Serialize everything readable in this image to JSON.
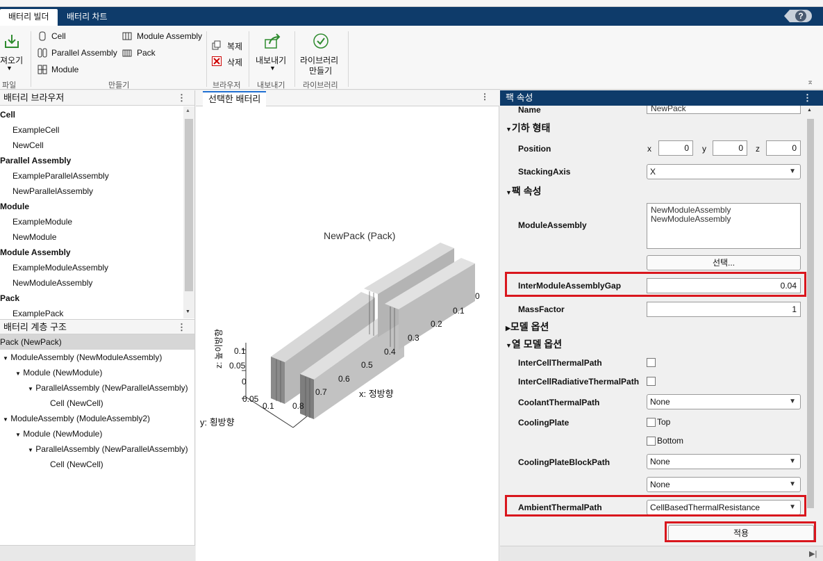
{
  "tabs": {
    "builder": "배터리 빌더",
    "chart": "배터리 차트"
  },
  "help_label": "?",
  "ribbon": {
    "file": {
      "import_label": "져오기",
      "section": "파일"
    },
    "create": {
      "cell": "Cell",
      "parallel": "Parallel Assembly",
      "module": "Module",
      "module_assembly": "Module Assembly",
      "pack": "Pack",
      "section": "만들기"
    },
    "browser": {
      "copy": "복제",
      "delete": "삭제",
      "section": "브라우저"
    },
    "export": {
      "label": "내보내기",
      "section": "내보내기"
    },
    "library": {
      "label1": "라이브러리",
      "label2": "만들기",
      "section": "라이브러리"
    }
  },
  "browser": {
    "title": "배터리 브라우저",
    "groups": [
      {
        "name": "Cell",
        "items": [
          "ExampleCell",
          "NewCell"
        ]
      },
      {
        "name": "Parallel Assembly",
        "items": [
          "ExampleParallelAssembly",
          "NewParallelAssembly"
        ]
      },
      {
        "name": "Module",
        "items": [
          "ExampleModule",
          "NewModule"
        ]
      },
      {
        "name": "Module Assembly",
        "items": [
          "ExampleModuleAssembly",
          "NewModuleAssembly"
        ]
      },
      {
        "name": "Pack",
        "items": [
          "ExamplePack"
        ]
      }
    ]
  },
  "hierarchy": {
    "title": "배터리 계층 구조",
    "items": [
      "Pack (NewPack)",
      "ModuleAssembly (NewModuleAssembly)",
      "Module (NewModule)",
      "ParallelAssembly (NewParallelAssembly)",
      "Cell (NewCell)",
      "ModuleAssembly (ModuleAssembly2)",
      "Module (NewModule)",
      "ParallelAssembly (NewParallelAssembly)",
      "Cell (NewCell)"
    ]
  },
  "viewer": {
    "tab": "선택한 배터리",
    "plot_title": "NewPack (Pack)",
    "x_label": "x: 정방향",
    "y_label": "y: 횡방향",
    "z_label": "z: 높이방향",
    "x_ticks": [
      "0",
      "0.1",
      "0.2",
      "0.3",
      "0.4",
      "0.5",
      "0.6",
      "0.7",
      "0.8"
    ],
    "y_ticks": [
      "0.05",
      "0.1"
    ],
    "z_ticks": [
      "0",
      "0.05",
      "0.1"
    ]
  },
  "props": {
    "title": "팩 속성",
    "name_label": "Name",
    "name_value": "NewPack",
    "geometry_section": "기하 형태",
    "position_label": "Position",
    "pos_x_label": "x",
    "pos_x": "0",
    "pos_y_label": "y",
    "pos_y": "0",
    "pos_z_label": "z",
    "pos_z": "0",
    "stacking_label": "StackingAxis",
    "stacking_value": "X",
    "pack_section": "팩 속성",
    "module_assembly_label": "ModuleAssembly",
    "module_assembly_values": [
      "NewModuleAssembly",
      "NewModuleAssembly"
    ],
    "select_button": "선택...",
    "gap_label": "InterModuleAssemblyGap",
    "gap_value": "0.04",
    "mass_label": "MassFactor",
    "mass_value": "1",
    "model_section": "모델 옵션",
    "thermal_section": "열 모델 옵션",
    "intercell_label": "InterCellThermalPath",
    "radiative_label": "InterCellRadiativeThermalPath",
    "coolant_label": "CoolantThermalPath",
    "coolant_value": "None",
    "coolingplate_label": "CoolingPlate",
    "top_label": "Top",
    "bottom_label": "Bottom",
    "blockpath_label": "CoolingPlateBlockPath",
    "blockpath_value1": "None",
    "blockpath_value2": "None",
    "ambient_label": "AmbientThermalPath",
    "ambient_value": "CellBasedThermalResistance",
    "apply_button": "적용"
  }
}
